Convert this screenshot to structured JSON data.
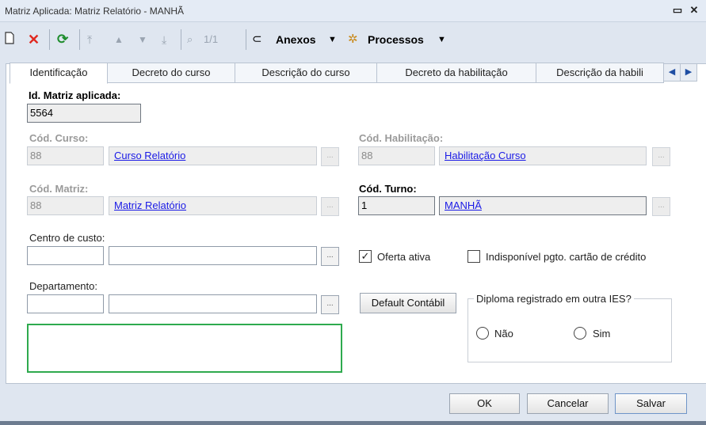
{
  "window": {
    "title": "Matriz Aplicada: Matriz Relatório - MANHÃ",
    "minimize": "▫",
    "close": "✕"
  },
  "toolbar": {
    "new_icon": "new-document-icon",
    "delete_icon": "delete-x-icon",
    "refresh_icon": "refresh-icon",
    "record_counter": "1/1",
    "anexos_label": "Anexos",
    "processos_label": "Processos"
  },
  "tabs": [
    {
      "label": "Identificação",
      "active": true
    },
    {
      "label": "Decreto do curso"
    },
    {
      "label": "Descrição do curso"
    },
    {
      "label": "Decreto da habilitação"
    },
    {
      "label": "Descrição da habili"
    }
  ],
  "form": {
    "id_matriz": {
      "label": "Id. Matriz aplicada:",
      "value": "5564"
    },
    "cod_curso": {
      "label": "Cód. Curso:",
      "value": "88",
      "link": "Curso Relatório"
    },
    "cod_habilitacao": {
      "label": "Cód. Habilitação:",
      "value": "88",
      "link": "Habilitação Curso"
    },
    "cod_matriz": {
      "label": "Cód. Matriz:",
      "value": "88",
      "link": "Matriz Relatório"
    },
    "cod_turno": {
      "label": "Cód. Turno:",
      "value": "1",
      "link": "MANHÃ"
    },
    "centro_custo": {
      "label": "Centro de custo:",
      "code": "",
      "desc": ""
    },
    "departamento": {
      "label": "Departamento:",
      "code": "",
      "desc": ""
    },
    "oferta_ativa": {
      "label": "Oferta ativa",
      "checked": true
    },
    "indisponivel": {
      "label": "Indisponível pgto. cartão de crédito",
      "checked": false
    },
    "default_contabil": "Default Contábil",
    "diploma": {
      "legend": "Diploma registrado em outra IES?",
      "options": [
        "Não",
        "Sim"
      ]
    },
    "ellipsis": "..."
  },
  "footer": {
    "ok": "OK",
    "cancel": "Cancelar",
    "save": "Salvar"
  }
}
